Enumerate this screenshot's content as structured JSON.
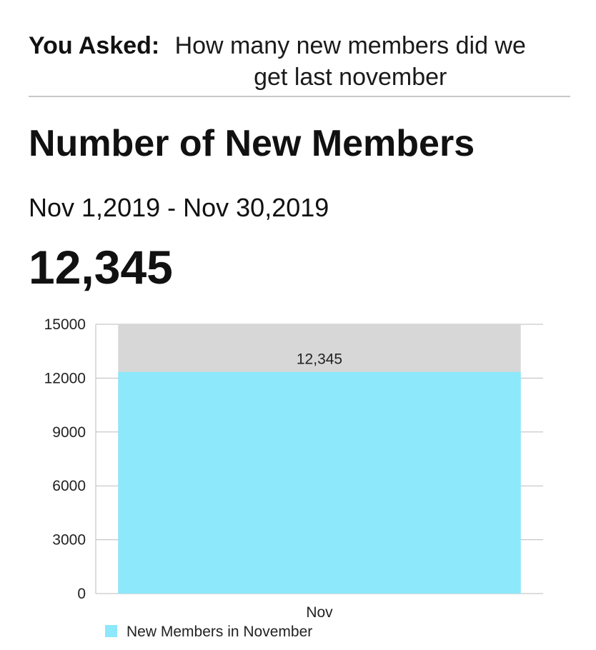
{
  "question": {
    "label": "You Asked:",
    "text": "How many new members did we get last november"
  },
  "card": {
    "title": "Number of New Members",
    "date_range": "Nov 1,2019 - Nov 30,2019",
    "big_number": "12,345"
  },
  "colors": {
    "bar": "#8ce8fa",
    "bar_background": "#d7d7d7",
    "grid": "#bbbbbb"
  },
  "chart_data": {
    "type": "bar",
    "categories": [
      "Nov"
    ],
    "series": [
      {
        "name": "New Members in November",
        "values": [
          12345
        ]
      }
    ],
    "data_labels": [
      "12,345"
    ],
    "ylim": [
      0,
      15000
    ],
    "yticks": [
      0,
      3000,
      6000,
      9000,
      12000,
      15000
    ],
    "grid": true,
    "legend_position": "bottom-left"
  }
}
